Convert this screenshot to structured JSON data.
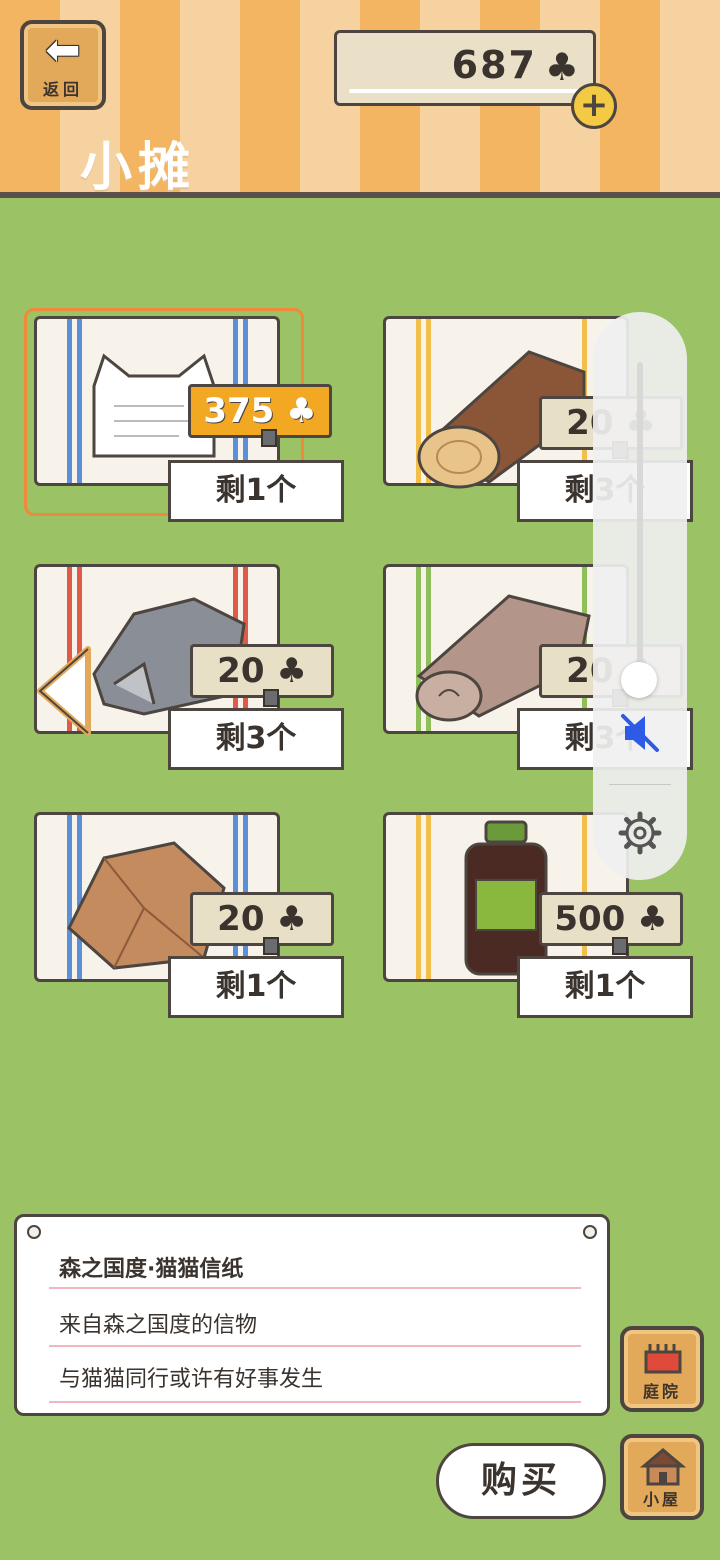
{
  "header": {
    "back_label": "返回",
    "title": "小摊",
    "currency_amount": "687",
    "currency_icon": "clover-icon",
    "add_currency_icon": "plus-icon"
  },
  "items": [
    {
      "name": "cat-letter-paper",
      "price": "375",
      "stock": "剩1个",
      "selected": true,
      "stripe_color": "#5b8fd8"
    },
    {
      "name": "log",
      "price": "20",
      "stock": "剩3个",
      "selected": false,
      "stripe_color": "#f2c04a"
    },
    {
      "name": "stone",
      "price": "20",
      "stock": "剩3个",
      "selected": false,
      "stripe_color": "#e05a4a"
    },
    {
      "name": "cloth-roll",
      "price": "20",
      "stock": "剩3个",
      "selected": false,
      "stripe_color": "#8fbf5a"
    },
    {
      "name": "paper-bag",
      "price": "20",
      "stock": "剩1个",
      "selected": false,
      "stripe_color": "#5b8fd8"
    },
    {
      "name": "bottle",
      "price": "500",
      "stock": "剩1个",
      "selected": false,
      "stripe_color": "#f2c04a"
    }
  ],
  "price_icon": "clover-icon",
  "description": {
    "title": "森之国度·猫猫信纸",
    "line1": "来自森之国度的信物",
    "line2": "与猫猫同行或许有好事发生"
  },
  "buttons": {
    "buy": "购买",
    "yard": "庭院",
    "house": "小屋"
  },
  "volume_panel": {
    "level": 0.1,
    "muted": true
  },
  "colors": {
    "grass": "#9bc265",
    "highlight_price": "#f3a823",
    "selected_frame": "#f08a3b"
  }
}
